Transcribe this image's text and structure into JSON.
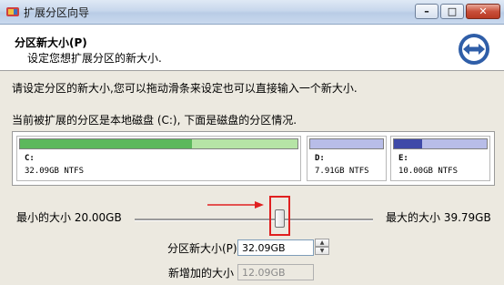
{
  "window": {
    "title": "扩展分区向导"
  },
  "header": {
    "title": "分区新大小(P)",
    "subtitle": "设定您想扩展分区的新大小."
  },
  "instruction": "请设定分区的新大小,您可以拖动滑条来设定也可以直接输入一个新大小.",
  "partition_info": "当前被扩展的分区是本地磁盘 (C:), 下面是磁盘的分区情况.",
  "partitions": [
    {
      "label": "C:",
      "info": "32.09GB NTFS",
      "fill_fraction": 1.0,
      "fill_color": "#5cb85c",
      "rest_color": "#b6e4a6"
    },
    {
      "label": "D:",
      "info": "7.91GB NTFS",
      "fill_fraction": 1.0,
      "fill_color": "#b8bde8",
      "rest_color": "#b8bde8"
    },
    {
      "label": "E:",
      "info": "10.00GB NTFS",
      "fill_fraction": 0.3,
      "fill_color": "#3f4aa8",
      "rest_color": "#b8bde8"
    }
  ],
  "slider": {
    "min_label": "最小的大小 20.00GB",
    "max_label": "最大的大小 39.79GB",
    "value_gb": 32.09,
    "min_gb": 20.0,
    "max_gb": 39.79
  },
  "new_size": {
    "label": "分区新大小(P)",
    "value": "32.09GB"
  },
  "added_size": {
    "label": "新增加的大小",
    "value": "12.09GB"
  },
  "colors": {
    "highlight": "#e02020",
    "arrow": "#e02020"
  },
  "icons": [
    "app-icon",
    "minimize-icon",
    "maximize-icon",
    "close-icon",
    "wizard-arrows-icon",
    "spin-up-icon",
    "spin-down-icon"
  ]
}
